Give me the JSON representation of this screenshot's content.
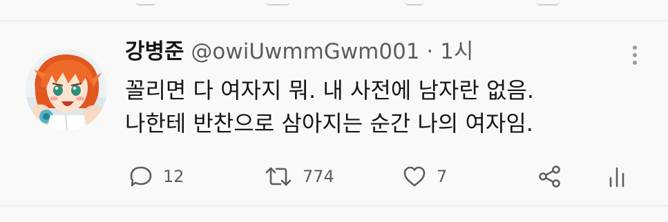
{
  "tweet": {
    "display_name": "강병준",
    "handle": "@owiUwmmGwm001",
    "separator": "·",
    "time": "1시",
    "text_lines": [
      "꼴리면 다 여자지 뭐. 내 사전에 남자란 없음.",
      "나한테 반찬으로 삼아지는 순간 나의 여자임."
    ],
    "actions": {
      "reply_count": "12",
      "retweet_count": "774",
      "like_count": "7"
    }
  },
  "icons": {
    "more": "more-vertical-icon",
    "reply": "reply-icon",
    "retweet": "retweet-icon",
    "like": "heart-icon",
    "share": "share-icon",
    "analytics": "analytics-icon"
  },
  "colors": {
    "text_primary": "#151515",
    "text_secondary": "#5c5c5c",
    "background": "#f9f9f9",
    "divider": "#e4e4e4"
  }
}
